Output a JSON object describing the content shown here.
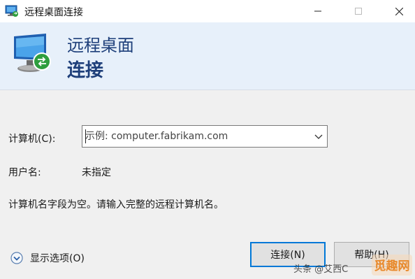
{
  "window": {
    "title": "远程桌面连接"
  },
  "titlebar": {
    "app_icon": "remote-desktop-icon",
    "controls": [
      "minimize-icon",
      "maximize-icon",
      "close-icon"
    ]
  },
  "banner": {
    "icon": "remote-desktop-monitor-icon",
    "line1": "远程桌面",
    "line2": "连接"
  },
  "form": {
    "computer_label": "计算机(C):",
    "computer_value": "",
    "computer_placeholder": "示例: computer.fabrikam.com",
    "username_label": "用户名:",
    "username_value": "未指定",
    "message": "计算机名字段为空。请输入完整的远程计算机名。"
  },
  "footer": {
    "options_label": "显示选项(O)",
    "options_icon": "chevron-down-circle-icon",
    "connect_label": "连接(N)",
    "help_label": "帮助(H)"
  },
  "watermark": {
    "text": "头条 @艾西C",
    "logo_text": "觅趣网"
  },
  "colors": {
    "banner_bg": "#e7f0fa",
    "banner_text": "#1e3f7a",
    "accent": "#0078d7",
    "window_bg": "#f0f0f0"
  }
}
